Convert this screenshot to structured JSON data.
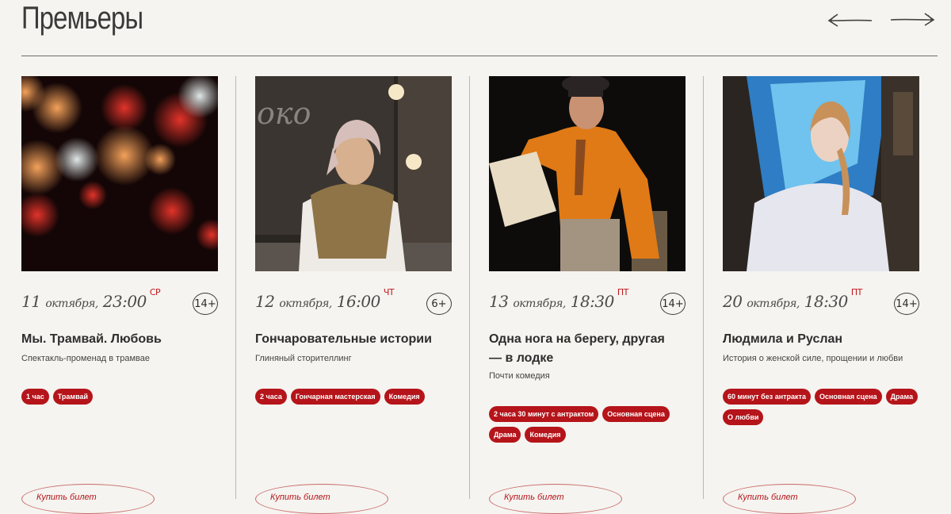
{
  "section": {
    "title": "Премьеры"
  },
  "nav": {
    "prev_icon": "arrow-left-icon",
    "next_icon": "arrow-right-icon"
  },
  "cards": [
    {
      "date_day": "11",
      "date_month": "октября,",
      "time": "23:00",
      "weekday": "СР",
      "age": "14+",
      "name": "Мы. Трамвай. Любовь",
      "subtitle": "Спектакль-променад в трамвае",
      "tags": [
        "1 час",
        "Трамвай"
      ],
      "buy_label": "Купить билет"
    },
    {
      "date_day": "12",
      "date_month": "октября,",
      "time": "16:00",
      "weekday": "ЧТ",
      "age": "6+",
      "name": "Гончаровательные истории",
      "subtitle": "Глиняный сторителлинг",
      "tags": [
        "2 часа",
        "Гончарная мастерская",
        "Комедия"
      ],
      "buy_label": "Купить билет"
    },
    {
      "date_day": "13",
      "date_month": "октября,",
      "time": "18:30",
      "weekday": "ПТ",
      "age": "14+",
      "name": "Одна нога на берегу, другая — в лодке",
      "subtitle": "Почти комедия",
      "tags": [
        "2 часа 30 минут с антрактом",
        "Основная сцена",
        "Драма",
        "Комедия"
      ],
      "buy_label": "Купить билет"
    },
    {
      "date_day": "20",
      "date_month": "октября,",
      "time": "18:30",
      "weekday": "ПТ",
      "age": "14+",
      "name": "Людмила и Руслан",
      "subtitle": "История о женской силе, прощении и любви",
      "tags": [
        "60 минут без антракта",
        "Основная сцена",
        "Драма",
        "О любви"
      ],
      "buy_label": "Купить билет"
    }
  ]
}
